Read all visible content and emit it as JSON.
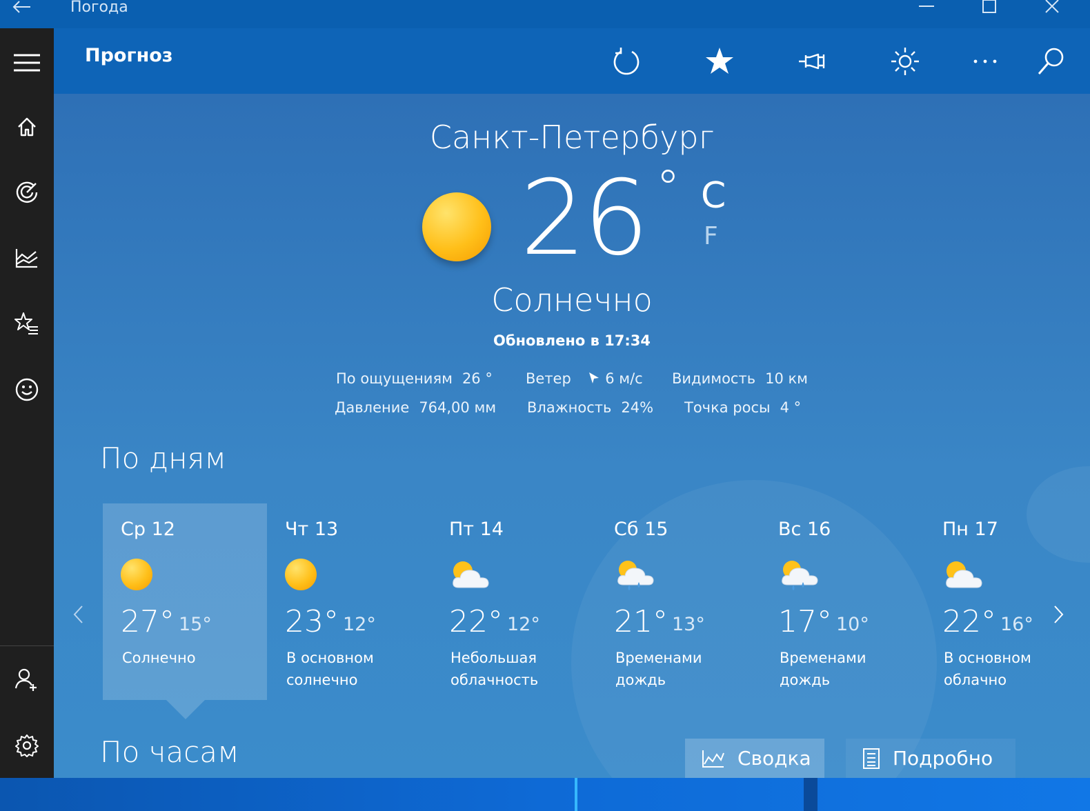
{
  "window": {
    "title": "Погода"
  },
  "header": {
    "title": "Прогноз"
  },
  "current": {
    "city": "Санкт-Петербург",
    "temperature": "26",
    "degree": "°",
    "unit_c": "C",
    "unit_f": "F",
    "condition": "Солнечно",
    "updated": "Обновлено в 17:34"
  },
  "details": {
    "feels_like": {
      "label": "По ощущениям",
      "value": "26 °"
    },
    "wind": {
      "label": "Ветер",
      "value": "6 м/с"
    },
    "visibility": {
      "label": "Видимость",
      "value": "10 км"
    },
    "pressure": {
      "label": "Давление",
      "value": "764,00 мм"
    },
    "humidity": {
      "label": "Влажность",
      "value": "24%"
    },
    "dew_point": {
      "label": "Точка росы",
      "value": "4 °"
    }
  },
  "daily": {
    "title": "По дням",
    "days": [
      {
        "name": "Ср 12",
        "hi": "27°",
        "lo": "15°",
        "desc": "Солнечно",
        "icon": "sun-icon"
      },
      {
        "name": "Чт 13",
        "hi": "23°",
        "lo": "12°",
        "desc": "В основном солнечно",
        "icon": "sun-icon"
      },
      {
        "name": "Пт 14",
        "hi": "22°",
        "lo": "12°",
        "desc": "Небольшая облачность",
        "icon": "partly-cloudy-icon"
      },
      {
        "name": "Сб 15",
        "hi": "21°",
        "lo": "13°",
        "desc": "Временами дождь",
        "icon": "rain-icon"
      },
      {
        "name": "Вс 16",
        "hi": "17°",
        "lo": "10°",
        "desc": "Временами дождь",
        "icon": "rain-icon"
      },
      {
        "name": "Пн 17",
        "hi": "22°",
        "lo": "16°",
        "desc": "В основном облачно",
        "icon": "partly-cloudy-icon"
      }
    ]
  },
  "hourly": {
    "title": "По часам",
    "summary_label": "Сводка",
    "details_label": "Подробно"
  },
  "colors": {
    "header": "#0e64b7",
    "nav": "#1f1f1f",
    "titlebar": "#0a5fb0"
  }
}
